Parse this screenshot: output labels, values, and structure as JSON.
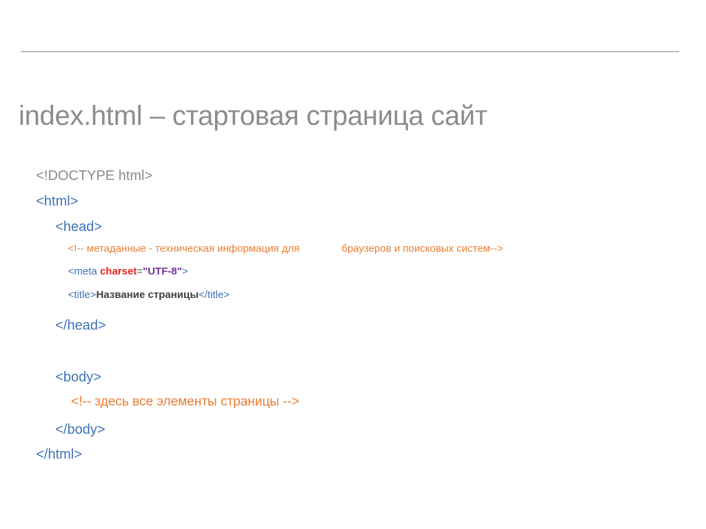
{
  "slide": {
    "title": "index.html – стартовая страница сайт"
  },
  "code": {
    "doctype": "<!DOCTYPE html>",
    "html_open": "<html>",
    "head_open": "<head>",
    "comment_meta_part1": "<!-- метаданные - техническая информация для",
    "comment_meta_part2": "браузеров и поисковых систем-->",
    "meta_tag_open": "<meta ",
    "meta_attr_name": "charset",
    "meta_equals": "=",
    "meta_attr_value": "\"UTF-8\"",
    "meta_tag_close": ">",
    "title_tag_open": "<title>",
    "title_text": "Название страницы",
    "title_tag_close": "</title>",
    "head_close": "</head>",
    "body_open": "<body>",
    "comment_body": "<!-- здесь все элементы страницы -->",
    "body_close": "</body>",
    "html_close": "</html>"
  },
  "colors": {
    "title_gray": "#8c8c8c",
    "code_gray": "#8a8a8a",
    "tag_blue": "#3e73b9",
    "comment_orange": "#ed7d31",
    "attr_red": "#e8251d",
    "value_purple": "#7030a0",
    "text_dark": "#3f3f3f",
    "rule_gray": "#a4a4a4"
  }
}
